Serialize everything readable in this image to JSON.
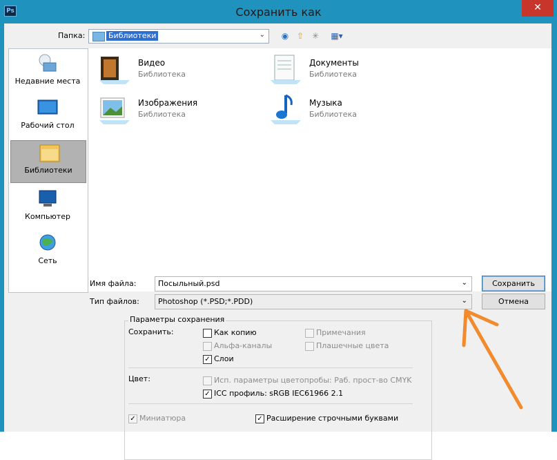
{
  "window": {
    "title": "Сохранить как",
    "app_icon": "Ps",
    "close": "✕"
  },
  "toolbar": {
    "folder_label": "Папка:",
    "folder_value": "Библиотеки"
  },
  "sidebar": {
    "items": [
      {
        "label": "Недавние места",
        "icon": "recent-places-icon"
      },
      {
        "label": "Рабочий стол",
        "icon": "desktop-icon"
      },
      {
        "label": "Библиотеки",
        "icon": "libraries-icon"
      },
      {
        "label": "Компьютер",
        "icon": "computer-icon"
      },
      {
        "label": "Сеть",
        "icon": "network-icon"
      }
    ]
  },
  "files": [
    {
      "name": "Видео",
      "type": "Библиотека",
      "icon": "video-library-icon"
    },
    {
      "name": "Документы",
      "type": "Библиотека",
      "icon": "documents-library-icon"
    },
    {
      "name": "Изображения",
      "type": "Библиотека",
      "icon": "pictures-library-icon"
    },
    {
      "name": "Музыка",
      "type": "Библиотека",
      "icon": "music-library-icon"
    }
  ],
  "form": {
    "filename_label": "Имя файла:",
    "filename_value": "Посыльный.psd",
    "filetype_label": "Тип файлов:",
    "filetype_value": "Photoshop (*.PSD;*.PDD)",
    "save_button": "Сохранить",
    "cancel_button": "Отмена"
  },
  "options": {
    "group_title": "Параметры сохранения",
    "save_label": "Сохранить:",
    "as_copy": "Как копию",
    "notes": "Примечания",
    "alpha": "Альфа-каналы",
    "spot": "Плашечные цвета",
    "layers": "Слои",
    "color_label": "Цвет:",
    "proof": "Исп. параметры цветопробы: Раб. прост-во CMYK",
    "icc": "ICC профиль: sRGB IEC61966 2.1",
    "thumbnail": "Миниатюра",
    "lowercase_ext": "Расширение строчными буквами"
  },
  "colors": {
    "titlebar": "#1f92bd",
    "annotation_arrow": "#f28a2e",
    "selection": "#2f6fcf"
  }
}
